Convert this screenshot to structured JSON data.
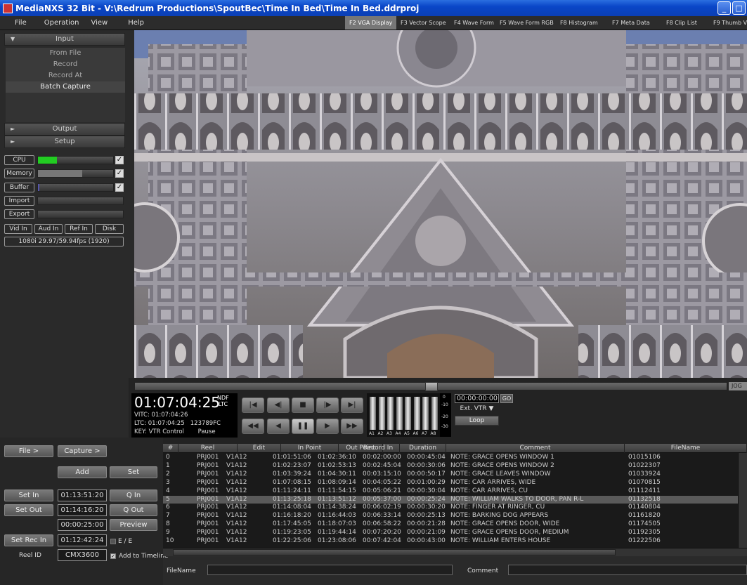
{
  "window": {
    "title": "MediaNXS 32 Bit - V:\\Redrum Productions\\SpoutBec\\Time In Bed\\Time In Bed.ddrproj",
    "minimize": "_",
    "maximize": "□"
  },
  "menu": [
    "File",
    "Operation",
    "View",
    "Help"
  ],
  "function_tabs": [
    "F2 VGA Display",
    "F3 Vector Scope",
    "F4 Wave Form",
    "F5 Wave Form RGB",
    "F8 Histogram",
    "F7 Meta Data",
    "F8 Clip List",
    "F9 Thumb Vie"
  ],
  "left": {
    "input_header": "Input",
    "input_items": [
      "From File",
      "Record",
      "Record At",
      "Batch Capture"
    ],
    "output_header": "Output",
    "setup_header": "Setup",
    "meters": [
      {
        "label": "CPU",
        "fill": 0.25,
        "color": "#22cc22",
        "checked": true
      },
      {
        "label": "Memory",
        "fill": 0.59,
        "color": "#777777",
        "checked": true
      },
      {
        "label": "Buffer",
        "fill": 0.02,
        "color": "#5555aa",
        "checked": true
      },
      {
        "label": "Import",
        "fill": 0,
        "color": "#777777",
        "checked": false
      },
      {
        "label": "Export",
        "fill": 0,
        "color": "#777777",
        "checked": false
      }
    ],
    "io_buttons": [
      "Vid In",
      "Aud In",
      "Ref In",
      "Disk"
    ],
    "format": "1080i 29.97/59.94fps (1920)"
  },
  "transport": {
    "timecode": "01:07:04:25",
    "ndf": "NDF",
    "ltc": "LTC",
    "vitc_label": "VITC:",
    "vitc": "01:07:04:26",
    "ltc_label": "LTC:",
    "ltc_value": "01:07:04:25",
    "ltc_extra": "123789FC",
    "key_label": "KEY:",
    "key_value": "VTR Control",
    "state": "Pause",
    "jog": "JOG",
    "scrub_position": 0.5,
    "tc_field": "00:00:00:00",
    "go": "GO",
    "ext_vtr": "Ext. VTR ▼",
    "loop": "Loop",
    "vu_labels": [
      "A1",
      "A2",
      "A3",
      "A4",
      "A5",
      "A6",
      "A7",
      "A8"
    ],
    "vu_levels": [
      0.95,
      0.95,
      0.95,
      0.95,
      0.95,
      0.95,
      0.95,
      0.95
    ],
    "vu_scale": [
      "0",
      "-10",
      "-20",
      "-30"
    ]
  },
  "capture": {
    "file_btn": "File >",
    "capture_btn": "Capture >",
    "add": "Add",
    "set": "Set",
    "set_in": "Set In",
    "set_in_tc": "01:13:51:20",
    "q_in": "Q In",
    "set_out": "Set Out",
    "set_out_tc": "01:14:16:20",
    "q_out": "Q Out",
    "duration_tc": "00:00:25:00",
    "preview": "Preview",
    "set_rec_in": "Set Rec In",
    "rec_in_tc": "01:12:42:24",
    "ee": "E / E",
    "reel_id_label": "Reel ID",
    "reel_id": "CMX3600",
    "add_to_timeline": "Add to Timeline"
  },
  "table": {
    "columns": [
      "#",
      "Reel",
      "Edit",
      "In Point",
      "Out Point",
      "Record In",
      "Duration",
      "Comment",
      "FileName"
    ],
    "selected_row": 5,
    "rows": [
      [
        "0",
        "PRJ001",
        "V1A12",
        "01:01:51:06",
        "01:02:36:10",
        "00:02:00:00",
        "00:00:45:04",
        "NOTE: GRACE OPENS WINDOW 1",
        "01015106"
      ],
      [
        "1",
        "PRJ001",
        "V1A12",
        "01:02:23:07",
        "01:02:53:13",
        "00:02:45:04",
        "00:00:30:06",
        "NOTE: GRACE OPENS WINDOW 2",
        "01022307"
      ],
      [
        "2",
        "PRJ001",
        "V1A12",
        "01:03:39:24",
        "01:04:30:11",
        "00:03:15:10",
        "00:00:50:17",
        "NOTE: GRACE LEAVES WINDOW",
        "01033924"
      ],
      [
        "3",
        "PRJ001",
        "V1A12",
        "01:07:08:15",
        "01:08:09:14",
        "00:04:05:22",
        "00:01:00:29",
        "NOTE: CAR ARRIVES, WIDE",
        "01070815"
      ],
      [
        "4",
        "PRJ001",
        "V1A12",
        "01:11:24:11",
        "01:11:54:15",
        "00:05:06:21",
        "00:00:30:04",
        "NOTE: CAR ARRIVES, CU",
        "01112411"
      ],
      [
        "5",
        "PRJ001",
        "V1A12",
        "01:13:25:18",
        "01:13:51:12",
        "00:05:37:00",
        "00:00:25:24",
        "NOTE: WILLIAM WALKS TO DOOR, PAN R-L",
        "01132518"
      ],
      [
        "6",
        "PRJ001",
        "V1A12",
        "01:14:08:04",
        "01:14:38:24",
        "00:06:02:19",
        "00:00:30:20",
        "NOTE: FINGER AT RINGER, CU",
        "01140804"
      ],
      [
        "7",
        "PRJ001",
        "V1A12",
        "01:16:18:20",
        "01:16:44:03",
        "00:06:33:14",
        "00:00:25:13",
        "NOTE: BARKING DOG APPEARS",
        "01161820"
      ],
      [
        "8",
        "PRJ001",
        "V1A12",
        "01:17:45:05",
        "01:18:07:03",
        "00:06:58:22",
        "00:00:21:28",
        "NOTE: GRACE OPENS DOOR, WIDE",
        "01174505"
      ],
      [
        "9",
        "PRJ001",
        "V1A12",
        "01:19:23:05",
        "01:19:44:14",
        "00:07:20:20",
        "00:00:21:09",
        "NOTE: GRACE OPENS DOOR, MEDIUM",
        "01192305"
      ],
      [
        "10",
        "PRJ001",
        "V1A12",
        "01:22:25:06",
        "01:23:08:06",
        "00:07:42:04",
        "00:00:43:00",
        "NOTE: WILLIAM ENTERS HOUSE",
        "01222506"
      ]
    ]
  },
  "footer": {
    "filename_label": "FileName",
    "comment_label": "Comment"
  }
}
